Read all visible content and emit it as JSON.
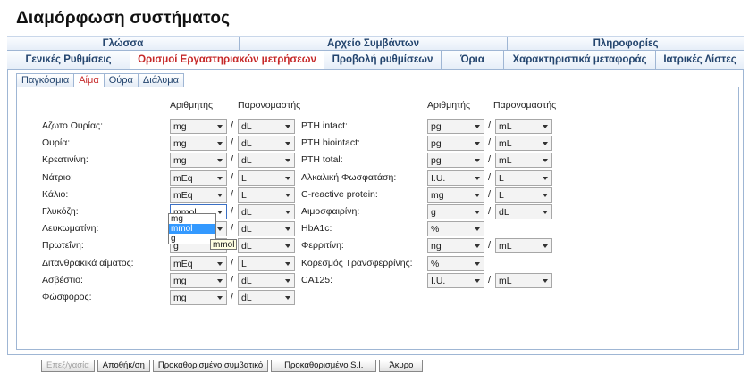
{
  "title": "Διαμόρφωση συστήματος",
  "top_tabs_row1": [
    "Γλώσσα",
    "Αρχείο Συμβάντων",
    "Πληροφορίες"
  ],
  "top_tabs_row2": [
    "Γενικές Ρυθμίσεις",
    "Ορισμοί Εργαστηριακών μετρήσεων",
    "Προβολή ρυθμίσεων",
    "Όρια",
    "Χαρακτηριστικά μεταφοράς",
    "Ιατρικές Λίστες"
  ],
  "active_top_tab": "Ορισμοί Εργαστηριακών μετρήσεων",
  "sub_tabs": [
    "Παγκόσμια",
    "Αίμα",
    "Ούρα",
    "Διάλυμα"
  ],
  "active_sub_tab": "Αίμα",
  "col_headers": {
    "numerator": "Αριθμητής",
    "denominator": "Παρονομαστής"
  },
  "left_rows": [
    {
      "label": "Αζωτο Ουρίας:",
      "num": "mg",
      "den": "dL"
    },
    {
      "label": "Ουρία:",
      "num": "mg",
      "den": "dL"
    },
    {
      "label": "Κρεατινίνη:",
      "num": "mg",
      "den": "dL"
    },
    {
      "label": "Νάτριο:",
      "num": "mEq",
      "den": "L"
    },
    {
      "label": "Κάλιο:",
      "num": "mEq",
      "den": "L"
    },
    {
      "label": "Γλυκόζη:",
      "num": "mmol",
      "den": "dL"
    },
    {
      "label": "Λευκωματίνη:",
      "num": "mg",
      "den": "dL"
    },
    {
      "label": "Πρωτεΐνη:",
      "num": "g",
      "den": "dL"
    },
    {
      "label": "Διτανθρακικά αίματος:",
      "num": "mEq",
      "den": "L"
    },
    {
      "label": "Ασβέστιο:",
      "num": "mg",
      "den": "dL"
    },
    {
      "label": "Φώσφορος:",
      "num": "mg",
      "den": "dL"
    }
  ],
  "right_rows": [
    {
      "label": "PTH intact:",
      "num": "pg",
      "den": "mL"
    },
    {
      "label": "PTH biointact:",
      "num": "pg",
      "den": "mL"
    },
    {
      "label": "PTH total:",
      "num": "pg",
      "den": "mL"
    },
    {
      "label": "Αλκαλική Φωσφατάση:",
      "num": "I.U.",
      "den": "L"
    },
    {
      "label": "C-reactive protein:",
      "num": "mg",
      "den": "L"
    },
    {
      "label": "Αιμοσφαιρίνη:",
      "num": "g",
      "den": "dL"
    },
    {
      "label": "HbA1c:",
      "num": "%",
      "den": null
    },
    {
      "label": "Φερριτίνη:",
      "num": "ng",
      "den": "mL"
    },
    {
      "label": "Κορεσμός Τρανσφερρίνης:",
      "num": "%",
      "den": null
    },
    {
      "label": "CA125:",
      "num": "I.U.",
      "den": "mL"
    }
  ],
  "dropdown_options": [
    "mg",
    "mmol",
    "g"
  ],
  "dropdown_selected": "mmol",
  "tooltip": "mmol",
  "buttons": [
    {
      "label": "Επεξ/γασία",
      "enabled": false
    },
    {
      "label": "Αποθήκ/ση",
      "enabled": true
    },
    {
      "label": "Προκαθορισμένο συμβατικό",
      "enabled": true
    },
    {
      "label": "Προκαθορισμένο S.I.",
      "enabled": true
    },
    {
      "label": "Άκυρο",
      "enabled": true
    }
  ],
  "colors": {
    "active_tab_text": "#c62828",
    "tab_text": "#24456e",
    "border": "#9fb6d4",
    "selection": "#3399ff"
  }
}
